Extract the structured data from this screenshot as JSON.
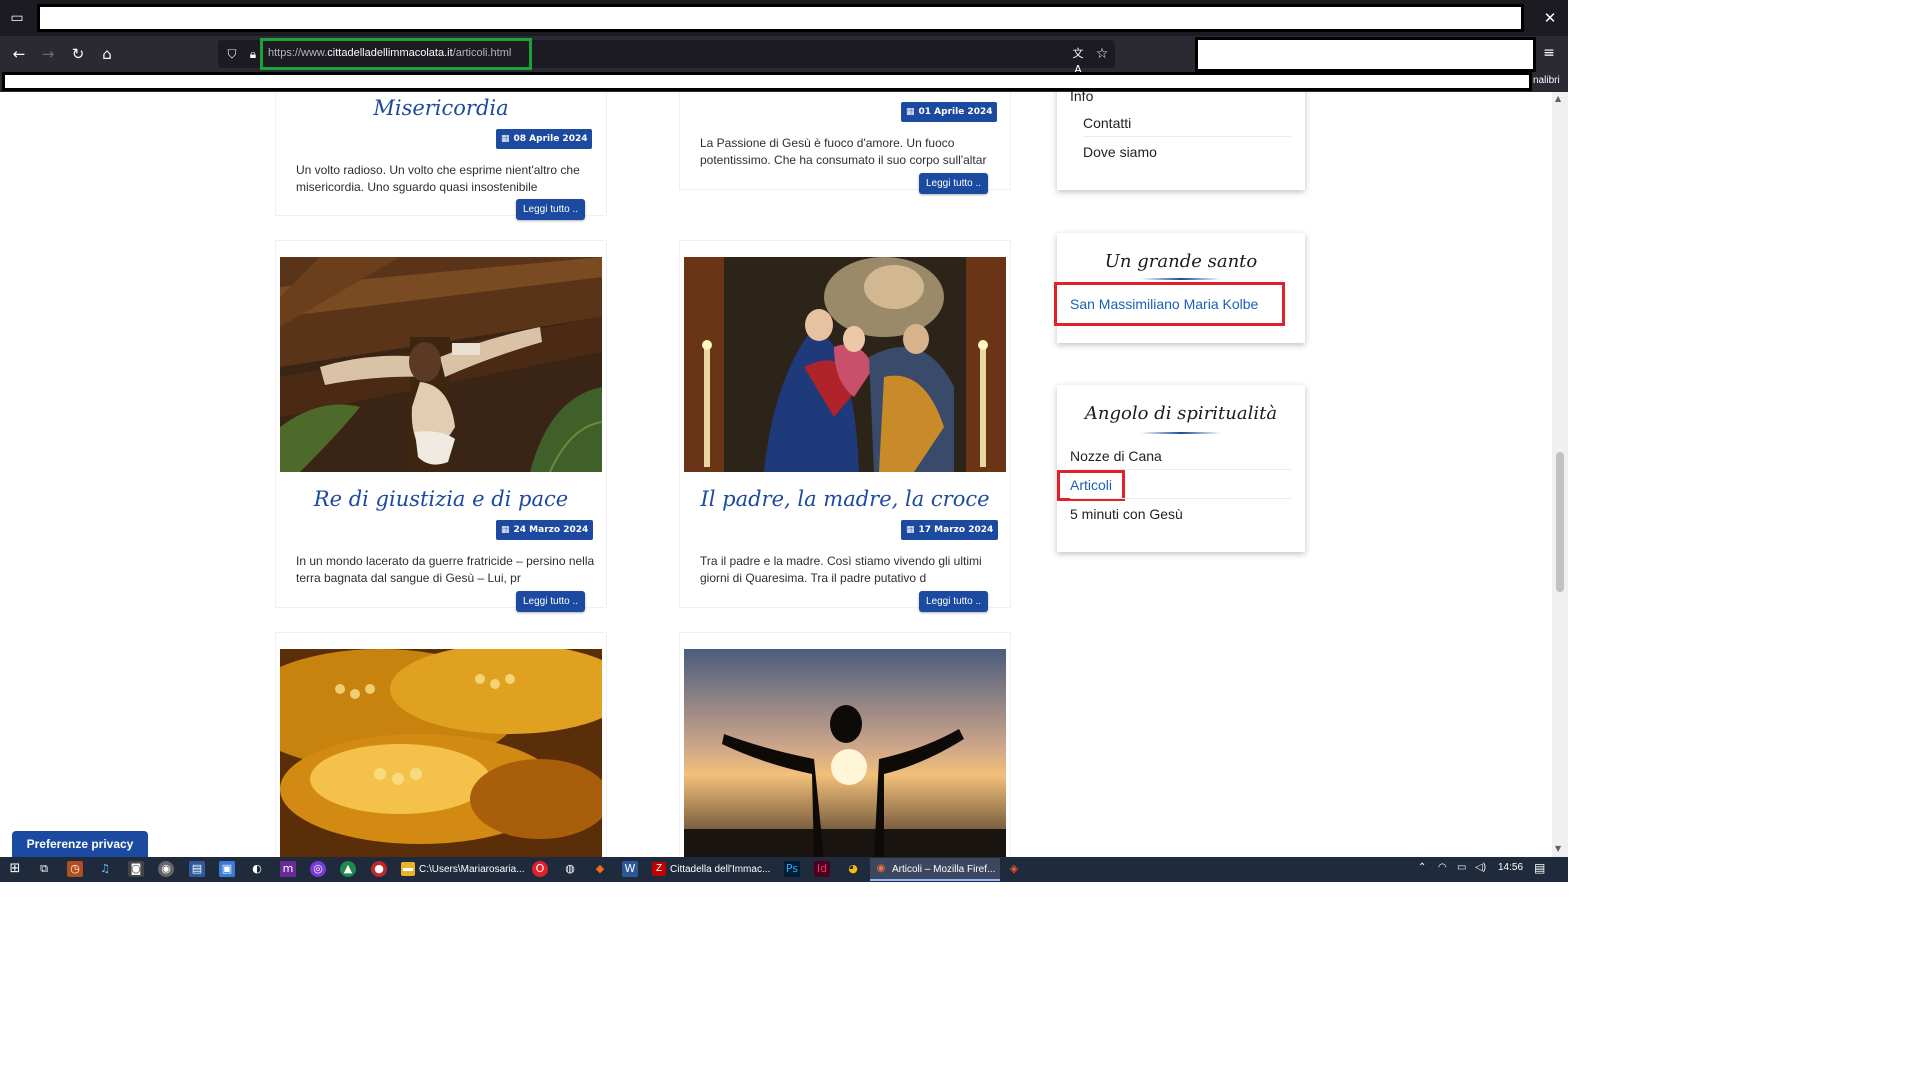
{
  "browser": {
    "url_prefix": "https://www.",
    "url_host": "cittadelladellimmacolata.it",
    "url_path": "/articoli.html",
    "bookmarks_tail": "nalibri"
  },
  "articles_top": [
    {
      "title": "Misericordia",
      "date": "08 Aprile 2024",
      "excerpt": "Un volto radioso. Un volto che esprime nient'altro che misericordia. Uno sguardo quasi insostenibile",
      "read_more": "Leggi tutto .."
    },
    {
      "title": "",
      "date": "01 Aprile 2024",
      "excerpt": "La Passione di Gesù è fuoco d'amore. Un fuoco potentissimo. Che ha consumato il suo corpo sull'altar",
      "read_more": "Leggi tutto .."
    }
  ],
  "articles_mid": [
    {
      "title": "Re di giustizia e di pace",
      "date": "24 Marzo 2024",
      "excerpt": "In un mondo lacerato da guerre fratricide – persino nella terra bagnata dal sangue di Gesù – Lui, pr",
      "read_more": "Leggi tutto .."
    },
    {
      "title": "Il padre, la madre, la croce",
      "date": "17 Marzo 2024",
      "excerpt": "Tra il padre e la madre. Così stiamo vivendo gli ultimi giorni di Quaresima. Tra il padre putativo d",
      "read_more": "Leggi tutto .."
    }
  ],
  "sidebar": {
    "info": {
      "heading_fragment": "Info",
      "links": [
        "Contatti",
        "Dove siamo"
      ]
    },
    "saint": {
      "title": "Un grande santo",
      "link": "San Massimiliano Maria Kolbe"
    },
    "spirituality": {
      "title": "Angolo di spiritualità",
      "links": [
        "Nozze di Cana",
        "Articoli",
        "5 minuti con Gesù"
      ]
    }
  },
  "privacy_button": "Preferenze privacy",
  "taskbar": {
    "tasks": [
      "C:\\Users\\Mariarosaria...",
      "Cittadella dell'Immac...",
      "Articoli – Mozilla Firef..."
    ],
    "time": "14:56"
  },
  "colors": {
    "accent": "#1c4aa0",
    "highlight_red": "#e0202a",
    "highlight_green": "#1aa33a"
  }
}
